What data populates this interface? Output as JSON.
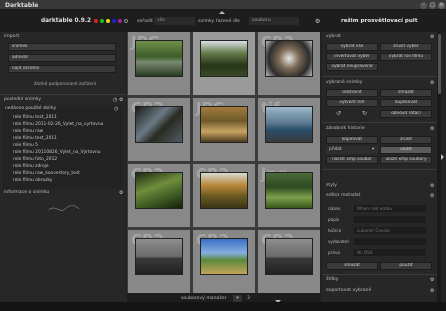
{
  "window": {
    "title": "Darktable"
  },
  "header": {
    "app_name": "darktable 0.9.2",
    "sort_label": "seřadit",
    "sort_value": "vše",
    "order_label": "snímky řazené dle",
    "order_value": "souboru",
    "mode_title": "režim prosvětlovací pult"
  },
  "color_labels": {
    "colors": [
      "#d22",
      "#2b2",
      "#22c",
      "#dd2",
      "#a2a",
      "#888"
    ]
  },
  "left": {
    "import": {
      "title": "import",
      "buttons": [
        "snímek",
        "adresář",
        "najít zařízení"
      ],
      "no_device": "žádné podporované zařízení"
    },
    "recent": {
      "title": "poslední snímky",
      "subtitle": "nedávno použité sbírky",
      "items": [
        "role filmu test_2011",
        "role filmu 2011-02-26_Vylet_na_vyrtovnu",
        "role filmu raw",
        "role filmu test_2011",
        "role filmu 5",
        "role filmu 20110826_Vylet_na_Vyrtovnu",
        "role filmu foto_2012",
        "role filmu zdroje",
        "role filmu raw_konvertory_test",
        "role filmu obrazky"
      ]
    },
    "info": {
      "title": "informace o snímku"
    }
  },
  "thumbnails": [
    {
      "ext": "JPG",
      "scene": "forest-lake"
    },
    {
      "ext": "",
      "scene": "dark-trees"
    },
    {
      "ext": "CR2",
      "scene": "tower-spiral"
    },
    {
      "ext": "CR2",
      "scene": "dark-wood"
    },
    {
      "ext": "JPG",
      "scene": "autumn-road"
    },
    {
      "ext": "tif",
      "scene": "coast"
    },
    {
      "ext": "CR2",
      "scene": "ferns"
    },
    {
      "ext": "CR2",
      "scene": "autumn-trees"
    },
    {
      "ext": "jpg",
      "scene": "green-field"
    },
    {
      "ext": "CR2",
      "scene": "plain"
    },
    {
      "ext": "CR2",
      "scene": "fields"
    },
    {
      "ext": "CR2",
      "scene": "plain"
    }
  ],
  "bottombar": {
    "zoom_label": "souborový manažer",
    "zoom_value": "3"
  },
  "right": {
    "select": {
      "title": "vybrat",
      "buttons": [
        "vybrat vše",
        "zrušit výběr",
        "invertovat výběr",
        "vybrat roli filmu",
        "vybrat neupravené"
      ]
    },
    "selected": {
      "title": "vybrané snímky",
      "buttons": [
        "odstranit",
        "smazat",
        "vytvořit hdr",
        "duplikovat",
        "obnovit rotaci"
      ]
    },
    "history": {
      "title": "zásobník historie",
      "buttons": [
        "kopírovat",
        "zrušit",
        "vložit",
        "načíst xmp soubor",
        "uložit xmp soubory"
      ],
      "paste_mode": "přidat"
    },
    "styles": {
      "title": "styly"
    },
    "metadata": {
      "title": "editor metadat",
      "fields": [
        {
          "label": "název",
          "value": "When raid embu"
        },
        {
          "label": "popis",
          "value": ""
        },
        {
          "label": "tvůrce",
          "value": "Lubomír Čevela"
        },
        {
          "label": "vydavatel",
          "value": ""
        },
        {
          "label": "práva",
          "value": "Nc OSA"
        }
      ],
      "buttons": [
        "smazat",
        "použít"
      ]
    },
    "tags": {
      "title": "štítky"
    },
    "export": {
      "title": "exportovat vybrané"
    }
  }
}
